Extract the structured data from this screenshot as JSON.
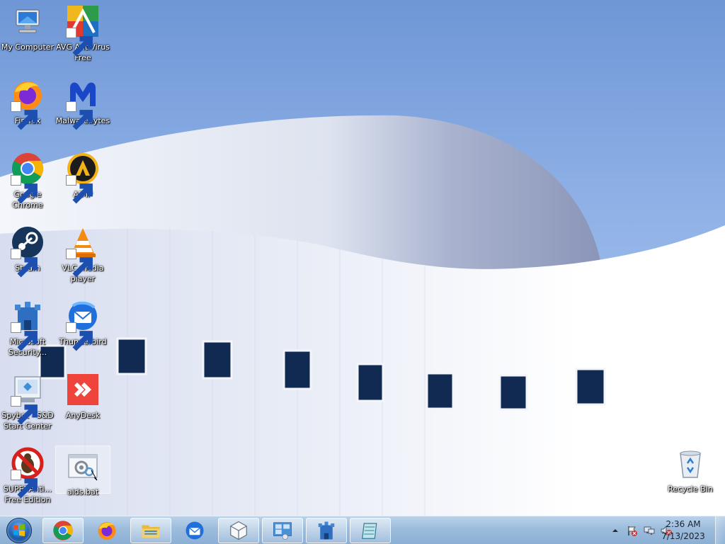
{
  "desktop": {
    "icons": [
      {
        "label": "My Computer",
        "icon": "computer-icon",
        "shortcut": false
      },
      {
        "label": "AVG AntiVirus Free",
        "icon": "avg-icon",
        "shortcut": true
      },
      {
        "label": "Firefox",
        "icon": "firefox-icon",
        "shortcut": true
      },
      {
        "label": "Malwarebytes",
        "icon": "malwarebytes-icon",
        "shortcut": true
      },
      {
        "label": "Google Chrome",
        "icon": "chrome-icon",
        "shortcut": true
      },
      {
        "label": "AIMP",
        "icon": "aimp-icon",
        "shortcut": true
      },
      {
        "label": "Steam",
        "icon": "steam-icon",
        "shortcut": true
      },
      {
        "label": "VLC media player",
        "icon": "vlc-icon",
        "shortcut": true
      },
      {
        "label": "Microsoft Security...",
        "icon": "microsoft-security-icon",
        "shortcut": true
      },
      {
        "label": "Thunderbird",
        "icon": "thunderbird-icon",
        "shortcut": true
      },
      {
        "label": "Spybot - S&D Start Center",
        "icon": "spybot-icon",
        "shortcut": true
      },
      {
        "label": "AnyDesk",
        "icon": "anydesk-icon",
        "shortcut": true
      },
      {
        "label": "SUPERAnti... Free Edition",
        "icon": "superantispyware-icon",
        "shortcut": true
      },
      {
        "label": "aids.bat",
        "icon": "batch-file-icon",
        "shortcut": false,
        "selected": true
      },
      {
        "label": "Recycle Bin",
        "icon": "recycle-bin-icon",
        "shortcut": false
      }
    ]
  },
  "taskbar": {
    "start": {
      "icon": "windows-logo-icon"
    },
    "pinned": [
      {
        "app": "Google Chrome",
        "icon": "chrome-icon"
      },
      {
        "app": "Firefox",
        "icon": "firefox-icon"
      },
      {
        "app": "Windows Explorer",
        "icon": "folder-icon"
      },
      {
        "app": "Thunderbird",
        "icon": "thunderbird-icon"
      },
      {
        "app": "Package app",
        "icon": "box-icon"
      },
      {
        "app": "Control panel",
        "icon": "control-panel-icon"
      },
      {
        "app": "Microsoft Security",
        "icon": "microsoft-security-icon"
      },
      {
        "app": "Notepad",
        "icon": "notepad-icon"
      }
    ],
    "tray": {
      "icons": [
        "show-hidden-icons-icon",
        "action-center-flag-icon",
        "network-icon",
        "volume-muted-icon"
      ],
      "time": "2:36 AM",
      "date": "7/13/2023"
    }
  },
  "colors": {
    "sky": "#8fb1e6",
    "taskbar": "#9dbcdc",
    "label_text": "#ffffff"
  }
}
